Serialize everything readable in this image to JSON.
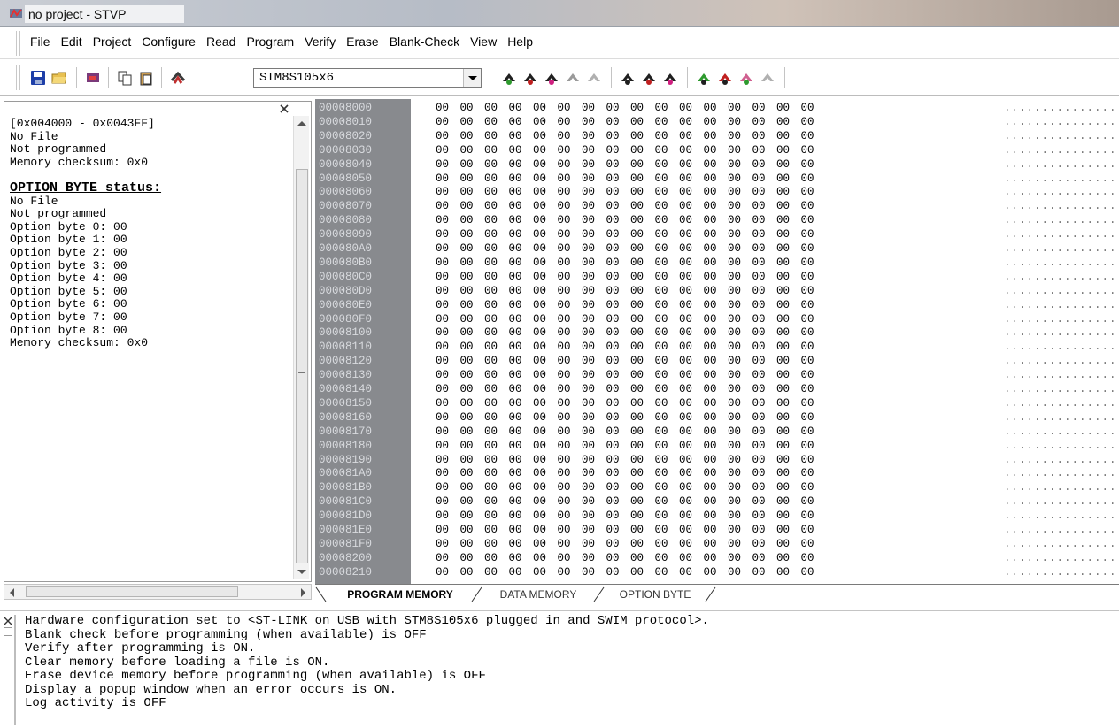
{
  "window": {
    "title": "no project - STVP"
  },
  "menu": [
    "File",
    "Edit",
    "Project",
    "Configure",
    "Read",
    "Program",
    "Verify",
    "Erase",
    "Blank-Check",
    "View",
    "Help"
  ],
  "toolbar": {
    "device": "STM8S105x6",
    "icons": [
      "save-icon",
      "open-icon",
      "programmer-icon",
      "copy-icon",
      "paste-icon",
      "device-icon",
      "read-all-icon",
      "read-current-icon",
      "program-all-icon",
      "program-current-icon",
      "verify-icon",
      "erase-icon",
      "blank-check-icon"
    ]
  },
  "info_panel": {
    "lines": [
      {
        "text": "[0x004000 - 0x0043FF]",
        "heading": false
      },
      {
        "text": "No File",
        "heading": false
      },
      {
        "text": "Not programmed",
        "heading": false
      },
      {
        "text": "Memory checksum: 0x0",
        "heading": false
      },
      {
        "text": "",
        "heading": false
      },
      {
        "text": "OPTION BYTE status:",
        "heading": true
      },
      {
        "text": "No File",
        "heading": false
      },
      {
        "text": "Not programmed",
        "heading": false
      },
      {
        "text": "Option byte 0: 00",
        "heading": false
      },
      {
        "text": "Option byte 1: 00",
        "heading": false
      },
      {
        "text": "Option byte 2: 00",
        "heading": false
      },
      {
        "text": "Option byte 3: 00",
        "heading": false
      },
      {
        "text": "Option byte 4: 00",
        "heading": false
      },
      {
        "text": "Option byte 5: 00",
        "heading": false
      },
      {
        "text": "Option byte 6: 00",
        "heading": false
      },
      {
        "text": "Option byte 7: 00",
        "heading": false
      },
      {
        "text": "Option byte 8: 00",
        "heading": false
      },
      {
        "text": "Memory checksum: 0x0",
        "heading": false
      }
    ]
  },
  "memory": {
    "addresses": [
      "00008000",
      "00008010",
      "00008020",
      "00008030",
      "00008040",
      "00008050",
      "00008060",
      "00008070",
      "00008080",
      "00008090",
      "000080A0",
      "000080B0",
      "000080C0",
      "000080D0",
      "000080E0",
      "000080F0",
      "00008100",
      "00008110",
      "00008120",
      "00008130",
      "00008140",
      "00008150",
      "00008160",
      "00008170",
      "00008180",
      "00008190",
      "000081A0",
      "000081B0",
      "000081C0",
      "000081D0",
      "000081E0",
      "000081F0",
      "00008200",
      "00008210"
    ],
    "bytes": "00 00 00 00 00 00 00 00 00 00 00 00 00 00 00 00",
    "ascii": "................"
  },
  "tabs": [
    "PROGRAM MEMORY",
    "DATA MEMORY",
    "OPTION BYTE"
  ],
  "log": [
    "Hardware configuration set to <ST-LINK on USB with STM8S105x6 plugged in and SWIM protocol>.",
    "Blank check before programming (when available) is OFF",
    "Verify after programming is ON.",
    "Clear memory before loading a file is ON.",
    "Erase device memory before programming (when available) is OFF",
    "Display a popup window when an error occurs is ON.",
    "Log activity is OFF"
  ]
}
